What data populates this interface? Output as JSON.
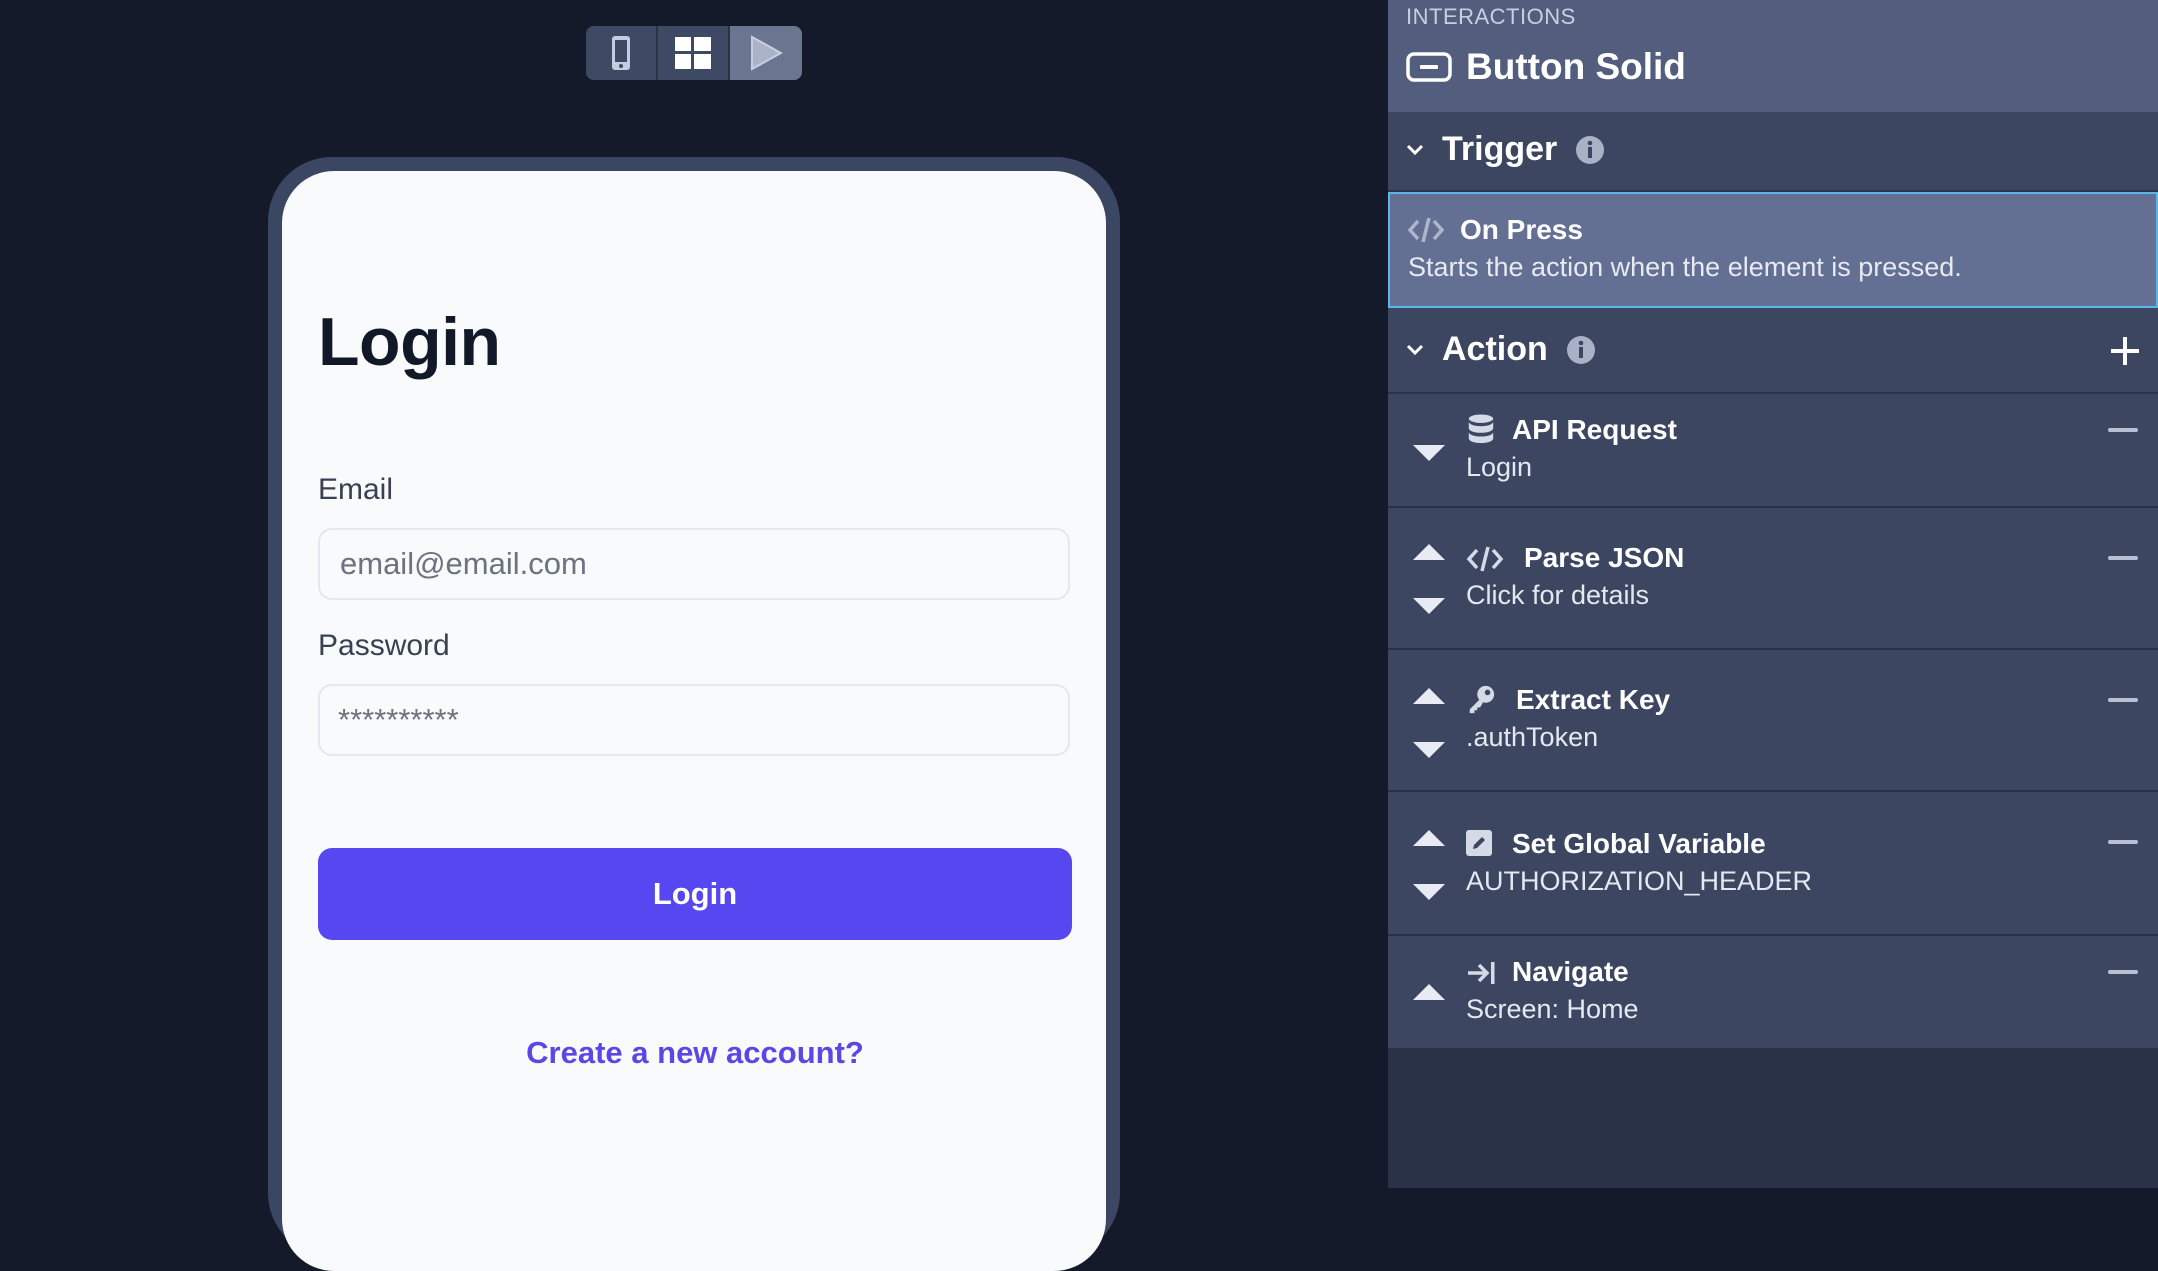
{
  "canvas": {
    "view_modes": [
      {
        "name": "phone-icon",
        "label": "Phone view"
      },
      {
        "name": "grid-icon",
        "label": "Grid view"
      },
      {
        "name": "play-icon",
        "label": "Preview"
      }
    ]
  },
  "login_screen": {
    "title": "Login",
    "email_label": "Email",
    "email_placeholder": "email@email.com",
    "password_label": "Password",
    "password_value": "**********",
    "submit_label": "Login",
    "create_account_link": "Create a new account?"
  },
  "panel": {
    "kicker": "INTERACTIONS",
    "element_name": "Button Solid",
    "trigger": {
      "section_title": "Trigger",
      "name": "On Press",
      "description": "Starts the action when the element is pressed."
    },
    "action": {
      "section_title": "Action",
      "items": [
        {
          "name": "API Request",
          "detail": "Login",
          "icon": "database-icon"
        },
        {
          "name": "Parse JSON",
          "detail": "Click for details",
          "icon": "code-icon"
        },
        {
          "name": "Extract Key",
          "detail": ".authToken",
          "icon": "key-icon"
        },
        {
          "name": "Set Global Variable",
          "detail": "AUTHORIZATION_HEADER",
          "icon": "edit-icon"
        },
        {
          "name": "Navigate",
          "detail": "Screen: Home",
          "icon": "navigate-icon"
        }
      ]
    }
  },
  "colors": {
    "canvas_bg": "#151a2b",
    "panel_bg": "#2a3248",
    "primary_button": "#5647f0",
    "link": "#5a47e6",
    "trigger_selected": "#636f93",
    "selection_border": "#5ab8e8"
  }
}
